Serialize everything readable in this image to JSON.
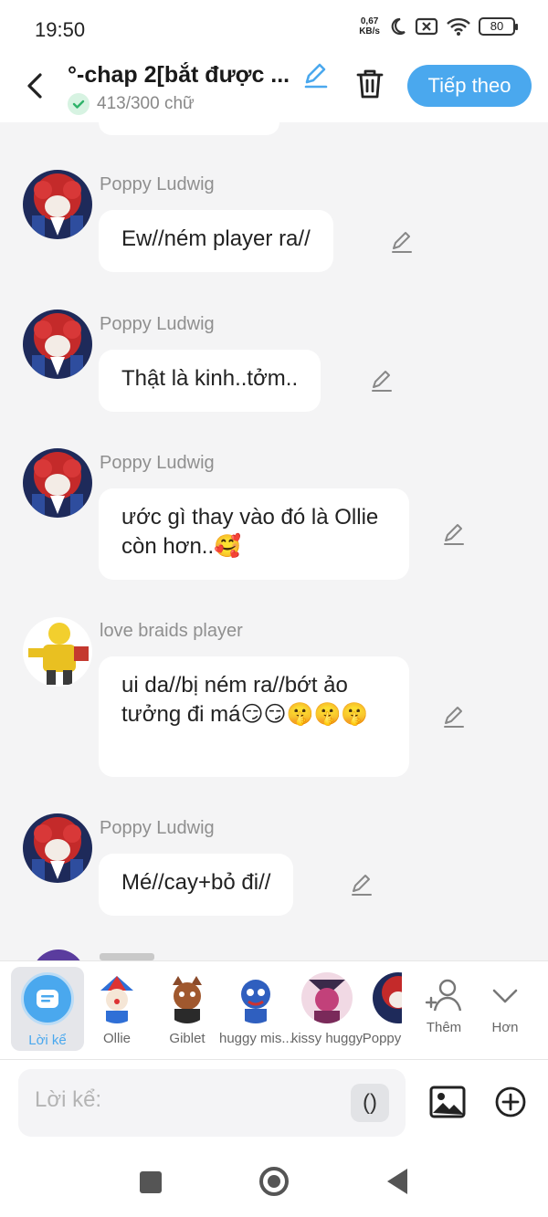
{
  "status_bar": {
    "time": "19:50",
    "net_speed_value": "0,67",
    "net_speed_unit": "KB/s",
    "battery": "80"
  },
  "header": {
    "title": "°-chap 2[bắt được ...",
    "word_count": "413/300 chữ",
    "next_label": "Tiếp theo"
  },
  "messages": [
    {
      "sender": "Poppy Ludwig",
      "text": "Ew//ném player ra//"
    },
    {
      "sender": "Poppy Ludwig",
      "text": "Thật là kinh..tởm.."
    },
    {
      "sender": "Poppy Ludwig",
      "text": "ước gì thay vào đó là Ollie còn hơn..🥰"
    },
    {
      "sender": "love braids player",
      "text": "ui da//bị ném ra//bớt ảo tưởng đi má😏😏🤫🤫🤫"
    },
    {
      "sender": "Poppy Ludwig",
      "text": "Mé//cay+bỏ đi//"
    }
  ],
  "characters": [
    {
      "name": "Lời kể",
      "selected": true
    },
    {
      "name": "Ollie"
    },
    {
      "name": "Giblet"
    },
    {
      "name": "huggy mis..."
    },
    {
      "name": "kissy huggy"
    },
    {
      "name": "Poppy"
    }
  ],
  "actions": {
    "add_label": "Thêm",
    "more_label": "Hơn"
  },
  "input": {
    "placeholder": "Lời kể:",
    "paren_label": "()"
  },
  "colors": {
    "accent": "#4aa8ee",
    "background": "#f4f4f5",
    "bubble": "#ffffff"
  }
}
